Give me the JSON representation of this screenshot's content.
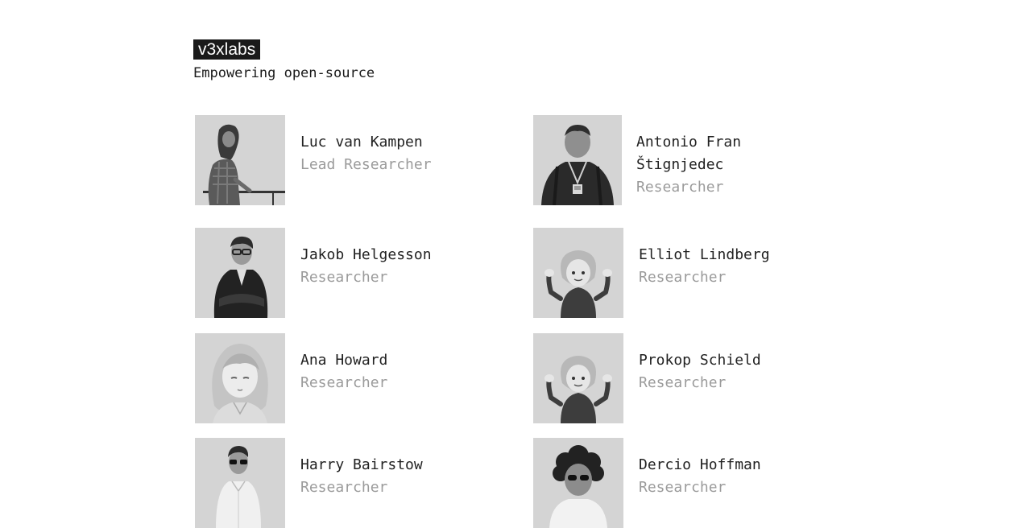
{
  "header": {
    "brand": "v3xlabs",
    "tagline": "Empowering open-source"
  },
  "members": [
    {
      "name": "Luc van Kampen",
      "role": "Lead Researcher",
      "avatar": "person-photo-railing"
    },
    {
      "name": "Antonio Fran Štignjedec",
      "role": "Researcher",
      "avatar": "person-photo-lanyard"
    },
    {
      "name": "Jakob Helgesson",
      "role": "Researcher",
      "avatar": "person-photo-suit"
    },
    {
      "name": "Elliot Lindberg",
      "role": "Researcher",
      "avatar": "shrug-emoji"
    },
    {
      "name": "Ana Howard",
      "role": "Researcher",
      "avatar": "anime-portrait"
    },
    {
      "name": "Prokop Schield",
      "role": "Researcher",
      "avatar": "shrug-emoji"
    },
    {
      "name": "Harry Bairstow",
      "role": "Researcher",
      "avatar": "person-photo-sunglasses"
    },
    {
      "name": "Dercio Hoffman",
      "role": "Researcher",
      "avatar": "person-photo-curly-hair"
    }
  ]
}
